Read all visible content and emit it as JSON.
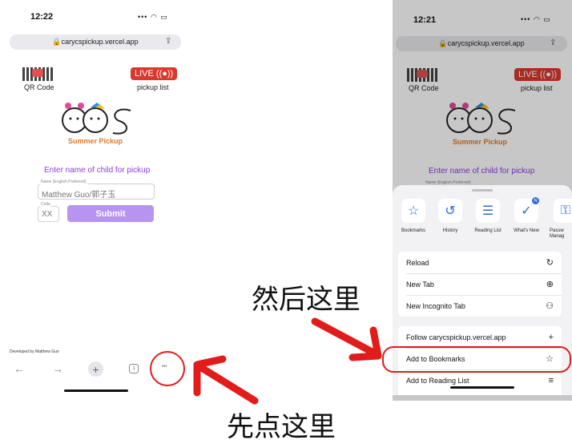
{
  "left": {
    "status_time": "12:22",
    "status_icons": "••• ◠ ▭",
    "url": "🔒carycspickup.vercel.app",
    "qr_label": "QR Code",
    "live_badge": "LIVE ((●))",
    "pickup_label": "pickup list",
    "logo_letters": "CCS",
    "summer_pickup": "Summer Pickup",
    "prompt": "Enter name of child for pickup",
    "name_label": "Name (English Preferred)",
    "name_placeholder": "Matthew Guo/郭子玉",
    "code_label": "Code",
    "code_placeholder": "XX",
    "submit": "Submit",
    "developed_by": "Developed by Matthew Guo",
    "nav": {
      "back": "←",
      "forward": "→",
      "new_tab": "+",
      "tabs": "1",
      "more": "•••"
    }
  },
  "right": {
    "status_time": "12:21",
    "url": "🔒carycspickup.vercel.app",
    "qr_label": "QR Code",
    "live_badge": "LIVE ((●))",
    "pickup_label": "pickup list",
    "logo_letters": "CCS",
    "summer_pickup": "Summer Pickup",
    "prompt": "Enter name of child for pickup",
    "name_label": "Name (English Preferred)",
    "quick_actions": [
      {
        "label": "Bookmarks",
        "icon": "☆"
      },
      {
        "label": "History",
        "icon": "↺"
      },
      {
        "label": "Reading List",
        "icon": "☰"
      },
      {
        "label": "What's New",
        "icon": "✓"
      },
      {
        "label": "Passw Manag",
        "icon": "⚿"
      }
    ],
    "whats_new_badge": "N",
    "menu_group_1": [
      {
        "label": "Reload",
        "icon": "↻"
      },
      {
        "label": "New Tab",
        "icon": "⊕"
      },
      {
        "label": "New Incognito Tab",
        "icon": "⚇"
      }
    ],
    "menu_group_2": [
      {
        "label": "Follow carycspickup.vercel.app",
        "icon": "+"
      },
      {
        "label": "Add to Bookmarks",
        "icon": "☆"
      },
      {
        "label": "Add to Reading List",
        "icon": "≡"
      }
    ]
  },
  "annotations": {
    "step1": "先点这里",
    "step2": "然后这里",
    "arrow_color": "#e21b1b"
  }
}
